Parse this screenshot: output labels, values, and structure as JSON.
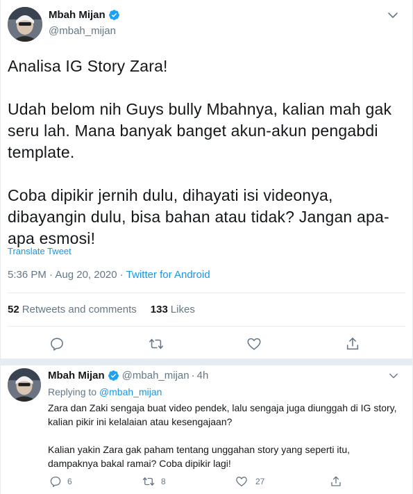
{
  "tweet": {
    "author_name": "Mbah Mijan",
    "author_handle": "@mbah_mijan",
    "text": "Analisa IG Story Zara!\n\nUdah belom nih Guys bully Mbahnya, kalian mah gak seru lah. Mana banyak banget akun-akun pengabdi template.\n\nCoba dipikir jernih dulu, dihayati isi videonya, dibayangin dulu, bisa bahan atau tidak? Jangan apa-apa esmosi!",
    "translate_label": "Translate Tweet",
    "timestamp": "5:36 PM · Aug 20, 2020 ·",
    "source": "Twitter for Android",
    "retweets_count": "52",
    "retweets_label": "Retweets and comments",
    "likes_count": "133",
    "likes_label": "Likes"
  },
  "reply": {
    "author_name": "Mbah Mijan",
    "author_handle": "@mbah_mijan",
    "time": "4h",
    "replying_prefix": "Replying to",
    "replying_to": "@mbah_mijan",
    "text": "Zara dan Zaki sengaja buat video pendek, lalu sengaja juga diunggah di IG story, kalian pikir ini kelalaian atau kesengajaan?\n\nKalian yakin Zara gak paham tentang unggahan story yang seperti itu, dampaknya bakal ramai? Coba dipikir lagi!",
    "reply_count": "6",
    "retweet_count": "8",
    "like_count": "27"
  },
  "icons": {
    "verified": "verified-badge-icon",
    "caret": "chevron-down-icon",
    "reply": "reply-icon",
    "retweet": "retweet-icon",
    "like": "heart-icon",
    "share": "share-icon"
  },
  "colors": {
    "accent": "#1b95e0",
    "muted": "#657786",
    "text": "#14171a",
    "divider": "#e6ecf0"
  }
}
